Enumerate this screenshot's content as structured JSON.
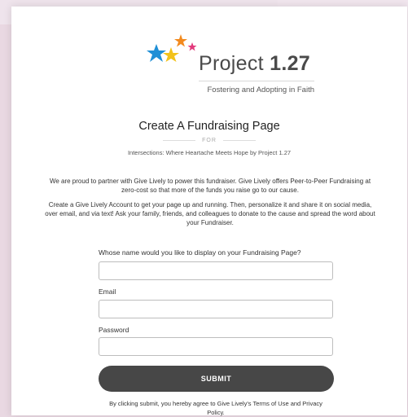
{
  "logo": {
    "name_light": "Project ",
    "name_bold": "1.27",
    "tagline": "Fostering and Adopting in Faith"
  },
  "page": {
    "title": "Create A Fundraising Page",
    "for_label": "FOR",
    "campaign": "Intersections: Where Heartache Meets Hope by Project 1.27",
    "intro_1": "We are proud to partner with Give Lively to power this fundraiser. Give Lively offers Peer-to-Peer Fundraising at zero-cost so that more of the funds you raise go to our cause.",
    "intro_2": "Create a Give Lively Account to get your page up and running. Then, personalize it and share it on social media, over email, and via text! Ask your family, friends, and colleagues to donate to the cause and spread the word about your Fundraiser."
  },
  "form": {
    "display_name_label": "Whose name would you like to display on your Fundraising Page?",
    "display_name_value": "",
    "email_label": "Email",
    "email_value": "",
    "password_label": "Password",
    "password_value": "",
    "submit_label": "SUBMIT",
    "legal_text": "By clicking submit, you hereby agree to Give Lively's Terms of Use and Privacy Policy."
  },
  "colors": {
    "star_blue": "#1f8fd6",
    "star_yellow": "#f2c21b",
    "star_orange": "#f28a1e",
    "star_pink": "#e23a7c",
    "button": "#474747"
  }
}
